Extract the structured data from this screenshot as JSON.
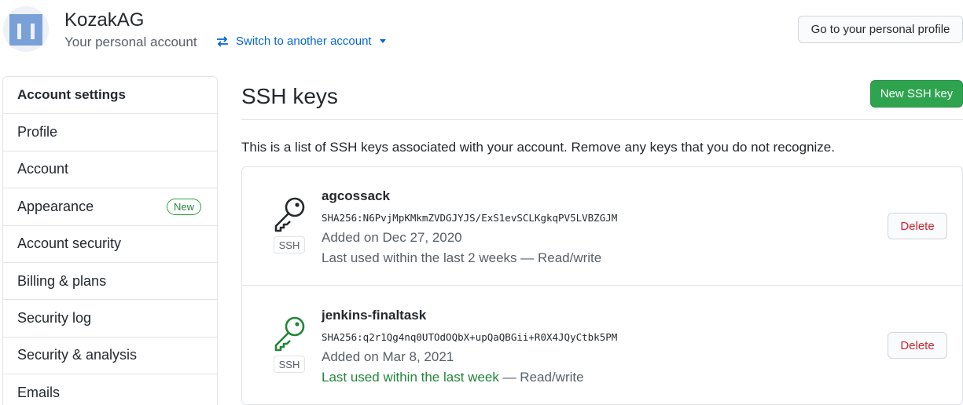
{
  "header": {
    "account_name": "KozakAG",
    "account_sub": "Your personal account",
    "switch_label": "Switch to another account",
    "profile_button": "Go to your personal profile"
  },
  "sidebar": {
    "items": [
      {
        "label": "Account settings",
        "badge": ""
      },
      {
        "label": "Profile",
        "badge": ""
      },
      {
        "label": "Account",
        "badge": ""
      },
      {
        "label": "Appearance",
        "badge": "New"
      },
      {
        "label": "Account security",
        "badge": ""
      },
      {
        "label": "Billing & plans",
        "badge": ""
      },
      {
        "label": "Security log",
        "badge": ""
      },
      {
        "label": "Security & analysis",
        "badge": ""
      },
      {
        "label": "Emails",
        "badge": ""
      }
    ]
  },
  "main": {
    "title": "SSH keys",
    "new_button": "New SSH key",
    "description": "This is a list of SSH keys associated with your account. Remove any keys that you do not recognize.",
    "keys": [
      {
        "title": "agcossack",
        "fingerprint": "SHA256:N6PvjMpKMkmZVDGJYJS/ExS1evSCLKgkqPV5LVBZGJM",
        "added": "Added on Dec 27, 2020",
        "last_used": "Last used within the last 2 weeks",
        "access": " — Read/write",
        "badge": "SSH",
        "delete_label": "Delete",
        "icon_color": "#24292e",
        "recent": false
      },
      {
        "title": "jenkins-finaltask",
        "fingerprint": "SHA256:q2r1Qg4nq0UTOdOQbX+upQaQBGii+R0X4JQyCtbk5PM",
        "added": "Added on Mar 8, 2021",
        "last_used": "Last used within the last week",
        "access": " — Read/write",
        "badge": "SSH",
        "delete_label": "Delete",
        "icon_color": "#22863a",
        "recent": true
      }
    ]
  },
  "colors": {
    "accent": "#0366d6",
    "success": "#2ea44f",
    "danger": "#cb2431"
  }
}
